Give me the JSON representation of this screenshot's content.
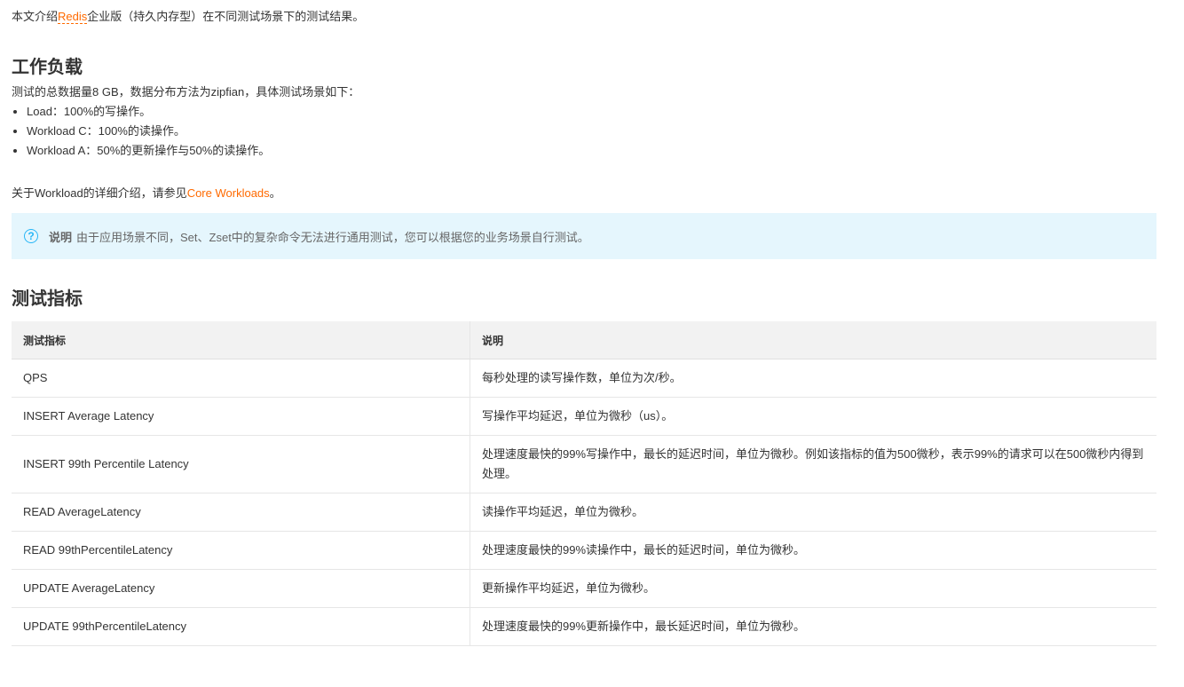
{
  "intro": {
    "before": "本文介绍",
    "link": "Redis",
    "after": "企业版（持久内存型）在不同测试场景下的测试结果。"
  },
  "section1": {
    "title": "工作负载",
    "desc": "测试的总数据量8 GB，数据分布方法为zipfian，具体测试场景如下：",
    "items": [
      "Load：100%的写操作。",
      "Workload C：100%的读操作。",
      "Workload A：50%的更新操作与50%的读操作。"
    ],
    "more_before": "关于Workload的详细介绍，请参见",
    "more_link": "Core Workloads",
    "more_after": "。"
  },
  "note": {
    "icon": "question-circle-icon",
    "label": "说明",
    "text": "由于应用场景不同，Set、Zset中的复杂命令无法进行通用测试，您可以根据您的业务场景自行测试。"
  },
  "section2": {
    "title": "测试指标",
    "headers": [
      "测试指标",
      "说明"
    ],
    "rows": [
      [
        "QPS",
        "每秒处理的读写操作数，单位为次/秒。"
      ],
      [
        "INSERT Average Latency",
        "写操作平均延迟，单位为微秒（us）。"
      ],
      [
        "INSERT 99th Percentile Latency",
        "处理速度最快的99%写操作中，最长的延迟时间，单位为微秒。例如该指标的值为500微秒，表示99%的请求可以在500微秒内得到处理。"
      ],
      [
        "READ AverageLatency",
        "读操作平均延迟，单位为微秒。"
      ],
      [
        "READ 99thPercentileLatency",
        "处理速度最快的99%读操作中，最长的延迟时间，单位为微秒。"
      ],
      [
        "UPDATE AverageLatency",
        "更新操作平均延迟，单位为微秒。"
      ],
      [
        "UPDATE 99thPercentileLatency",
        "处理速度最快的99%更新操作中，最长延迟时间，单位为微秒。"
      ]
    ]
  }
}
